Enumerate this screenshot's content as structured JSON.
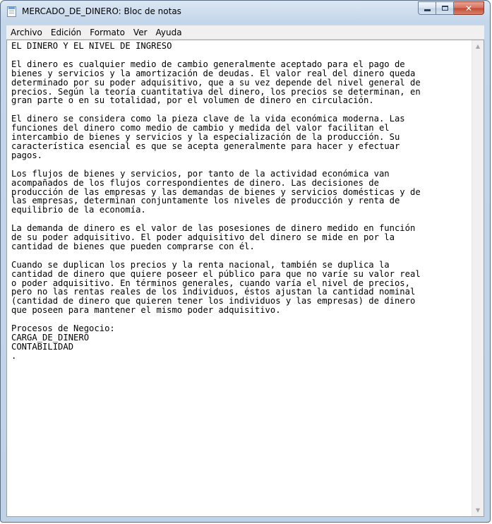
{
  "window": {
    "title": "MERCADO_DE_DINERO: Bloc de notas",
    "app_icon": "notepad-icon"
  },
  "caption_buttons": {
    "minimize_icon": "minimize-icon",
    "maximize_icon": "maximize-icon",
    "close_icon": "close-icon",
    "close_color": "#c14a32"
  },
  "menu": {
    "items": [
      {
        "label": "Archivo"
      },
      {
        "label": "Edición"
      },
      {
        "label": "Formato"
      },
      {
        "label": "Ver"
      },
      {
        "label": "Ayuda"
      }
    ]
  },
  "document": {
    "text": "EL DINERO Y EL NIVEL DE INGRESO\n\nEl dinero es cualquier medio de cambio generalmente aceptado para el pago de\nbienes y servicios y la amortización de deudas. El valor real del dinero queda\ndeterminado por su poder adquisitivo, que a su vez depende del nivel general de\nprecios. Según la teoría cuantitativa del dinero, los precios se determinan, en\ngran parte o en su totalidad, por el volumen de dinero en circulación.\n\nEl dinero se considera como la pieza clave de la vida económica moderna. Las\nfunciones del dinero como medio de cambio y medida del valor facilitan el\nintercambio de bienes y servicios y la especialización de la producción. Su\ncaracterística esencial es que se acepta generalmente para hacer y efectuar\npagos.\n\nLos flujos de bienes y servicios, por tanto de la actividad económica van\nacompañados de los flujos correspondientes de dinero. Las decisiones de\nproducción de las empresas y las demandas de bienes y servicios domésticas y de\nlas empresas, determinan conjuntamente los niveles de producción y renta de\nequilibrio de la economía.\n\nLa demanda de dinero es el valor de las posesiones de dinero medido en función\nde su poder adquisitivo. El poder adquisitivo del dinero se mide en por la\ncantidad de bienes que pueden comprarse con él.\n\nCuando se duplican los precios y la renta nacional, también se duplica la\ncantidad de dinero que quiere poseer el público para que no varíe su valor real\no poder adquisitivo. En términos generales, cuando varía el nivel de precios,\npero no las rentas reales de los individuos, éstos ajustan la cantidad nominal\n(cantidad de dinero que quieren tener los individuos y las empresas) de dinero\nque poseen para mantener el mismo poder adquisitivo.\n\nProcesos de Negocio:\nCARGA_DE_DINERO\nCONTABILIDAD\n."
  },
  "scrollbar": {
    "up_icon": "scroll-up-arrow-icon",
    "down_icon": "scroll-down-arrow-icon"
  }
}
